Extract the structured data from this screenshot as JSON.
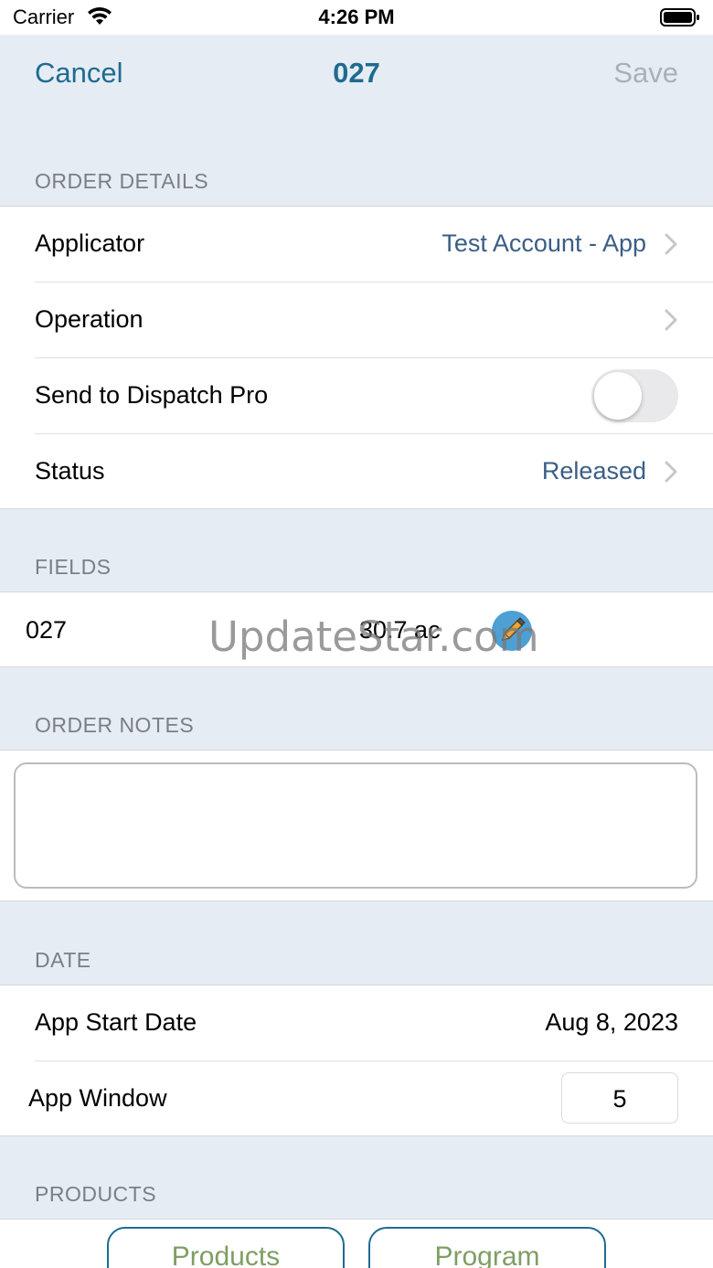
{
  "status_bar": {
    "carrier": "Carrier",
    "time": "4:26 PM"
  },
  "nav": {
    "cancel": "Cancel",
    "title": "027",
    "save": "Save"
  },
  "order_details": {
    "header": "ORDER DETAILS",
    "applicator_label": "Applicator",
    "applicator_value": "Test Account - App",
    "operation_label": "Operation",
    "dispatch_label": "Send to Dispatch Pro",
    "dispatch_on": false,
    "status_label": "Status",
    "status_value": "Released"
  },
  "fields": {
    "header": "FIELDS",
    "items": [
      {
        "name": "027",
        "acres": "30.7 ac"
      }
    ]
  },
  "watermark": "UpdateStar.com",
  "order_notes": {
    "header": "ORDER NOTES",
    "value": ""
  },
  "date": {
    "header": "DATE",
    "start_label": "App Start Date",
    "start_value": "Aug 8, 2023",
    "window_label": "App Window",
    "window_value": "5"
  },
  "products": {
    "header": "PRODUCTS",
    "products_button": "Products",
    "program_button": "Program"
  },
  "colors": {
    "accent": "#1e6b90",
    "value_blue": "#3a5e86",
    "button_text": "#7f9e64"
  }
}
